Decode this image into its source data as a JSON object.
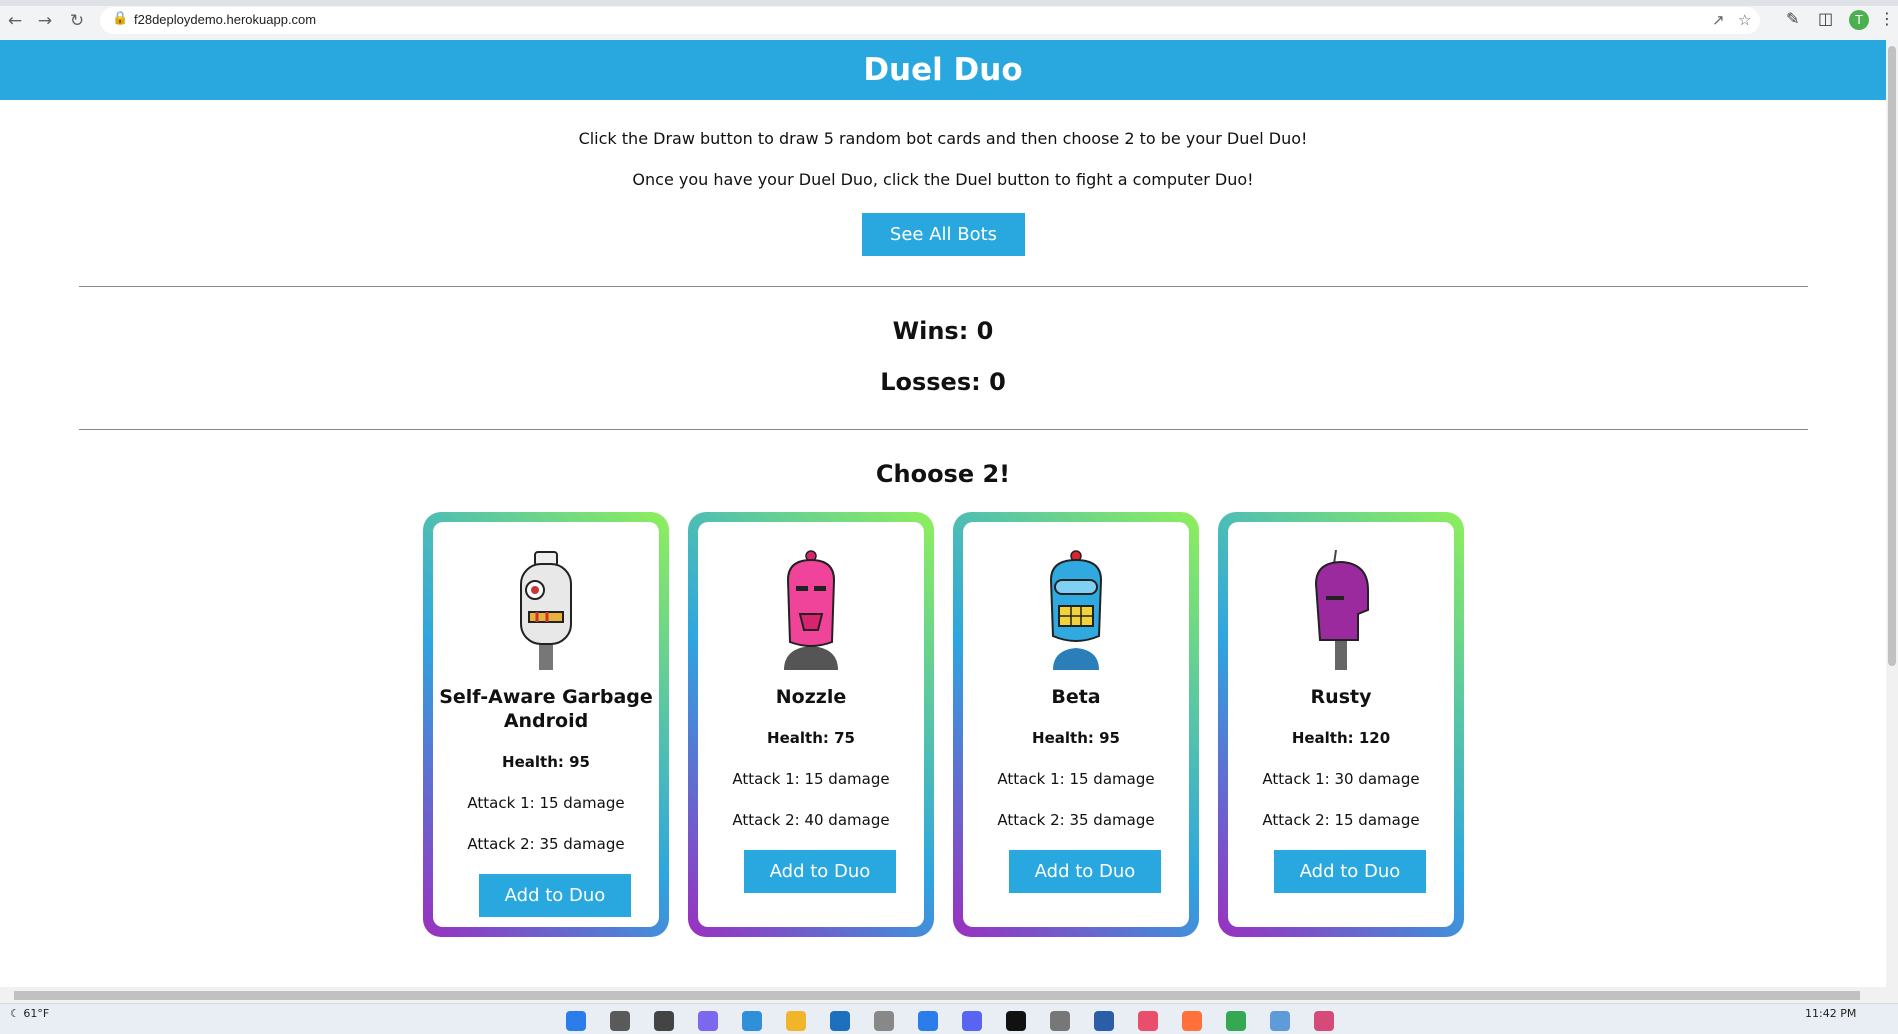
{
  "browser": {
    "url": "f28deploydemo.herokuapp.com",
    "profile_initial": "T"
  },
  "page": {
    "title": "Duel Duo",
    "intro_line1": "Click the Draw button to draw 5 random bot cards and then choose 2 to be your Duel Duo!",
    "intro_line2": "Once you have your Duel Duo, click the Duel button to fight a computer Duo!",
    "see_all_label": "See All Bots",
    "wins": "Wins: 0",
    "losses": "Losses: 0",
    "choose_heading": "Choose 2!",
    "add_label": "Add to Duo"
  },
  "cards": [
    {
      "name": "Self-Aware Garbage Android",
      "health": "Health: 95",
      "attack1": "Attack 1: 15 damage",
      "attack2": "Attack 2: 35 damage",
      "color": "#e8e8e8"
    },
    {
      "name": "Nozzle",
      "health": "Health: 75",
      "attack1": "Attack 1: 15 damage",
      "attack2": "Attack 2: 40 damage",
      "color": "#f0449a"
    },
    {
      "name": "Beta",
      "health": "Health: 95",
      "attack1": "Attack 1: 15 damage",
      "attack2": "Attack 2: 35 damage",
      "color": "#2fa9e0"
    },
    {
      "name": "Rusty",
      "health": "Health: 120",
      "attack1": "Attack 1: 30 damage",
      "attack2": "Attack 2: 15 damage",
      "color": "#9b2a9e"
    }
  ],
  "taskbar": {
    "temperature": "61°F",
    "clock": "11:42 PM"
  },
  "colors": {
    "header": "#29a8e0",
    "button": "#29a8e0",
    "gradient": [
      "#9b2fbf",
      "#2ea5e0",
      "#8ef05a"
    ]
  }
}
